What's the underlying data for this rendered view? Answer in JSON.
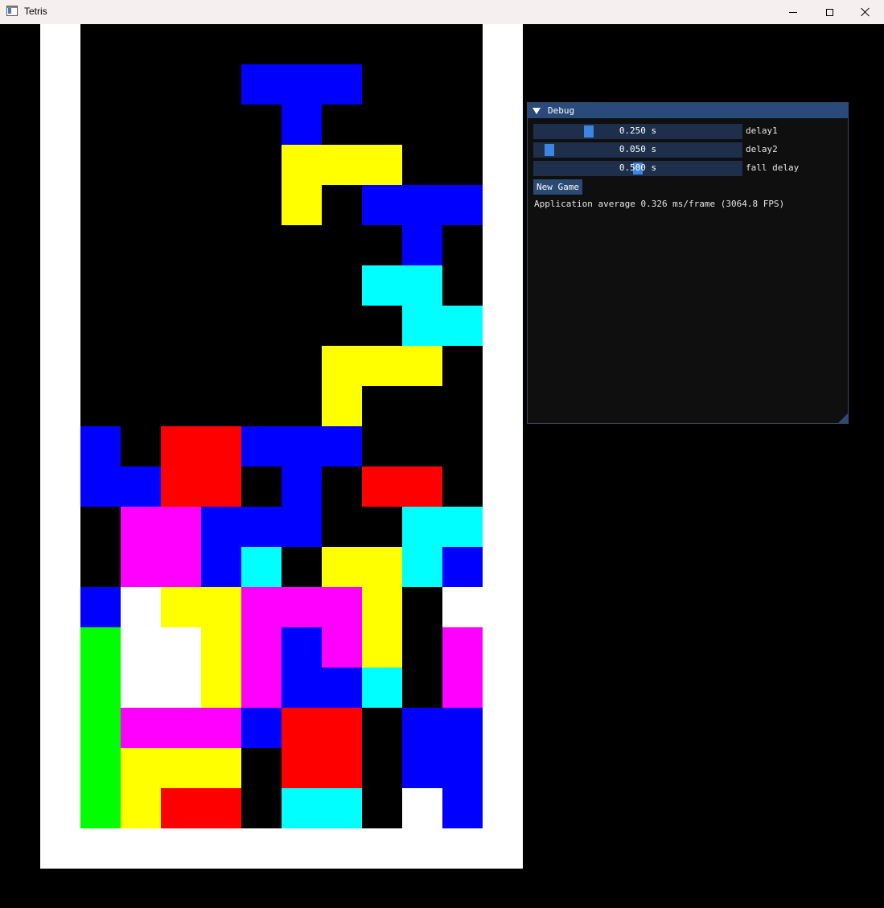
{
  "window": {
    "title": "Tetris",
    "controls": [
      "minimize-icon",
      "maximize-icon",
      "close-icon"
    ]
  },
  "colors": {
    "blue": "#0000ff",
    "yellow": "#ffff00",
    "cyan": "#00ffff",
    "red": "#ff0000",
    "magenta": "#ff00ff",
    "green": "#00ff00",
    "white": "#ffffff"
  },
  "board": {
    "columns": 10,
    "rows": 20,
    "grid": [
      "..........",
      "....BBB...",
      ".....B....",
      ".....YYY..",
      ".....Y.BBB",
      "........B.",
      ".......CC.",
      "........CC",
      "......YYY.",
      "......Y...",
      "B.RRBBB...",
      "BBRR.B.RR.",
      ".MMBBB..CC",
      ".MMBC.YYCB",
      "BWYYMMMY.W",
      "GWWYMBMY.M",
      "GWWYMBBC.M",
      "GMMMBRR.BB",
      "GYYY.RR.BB",
      "GYRR.CC.WB"
    ]
  },
  "debug": {
    "title": "Debug",
    "sliders": [
      {
        "label": "delay1",
        "value": "0.250 s",
        "fraction": 0.25
      },
      {
        "label": "delay2",
        "value": "0.050 s",
        "fraction": 0.05
      },
      {
        "label": "fall delay",
        "value": "0.500 s",
        "fraction": 0.5
      }
    ],
    "new_game_label": "New Game",
    "fps_text": "Application average 0.326 ms/frame (3064.8 FPS)"
  }
}
